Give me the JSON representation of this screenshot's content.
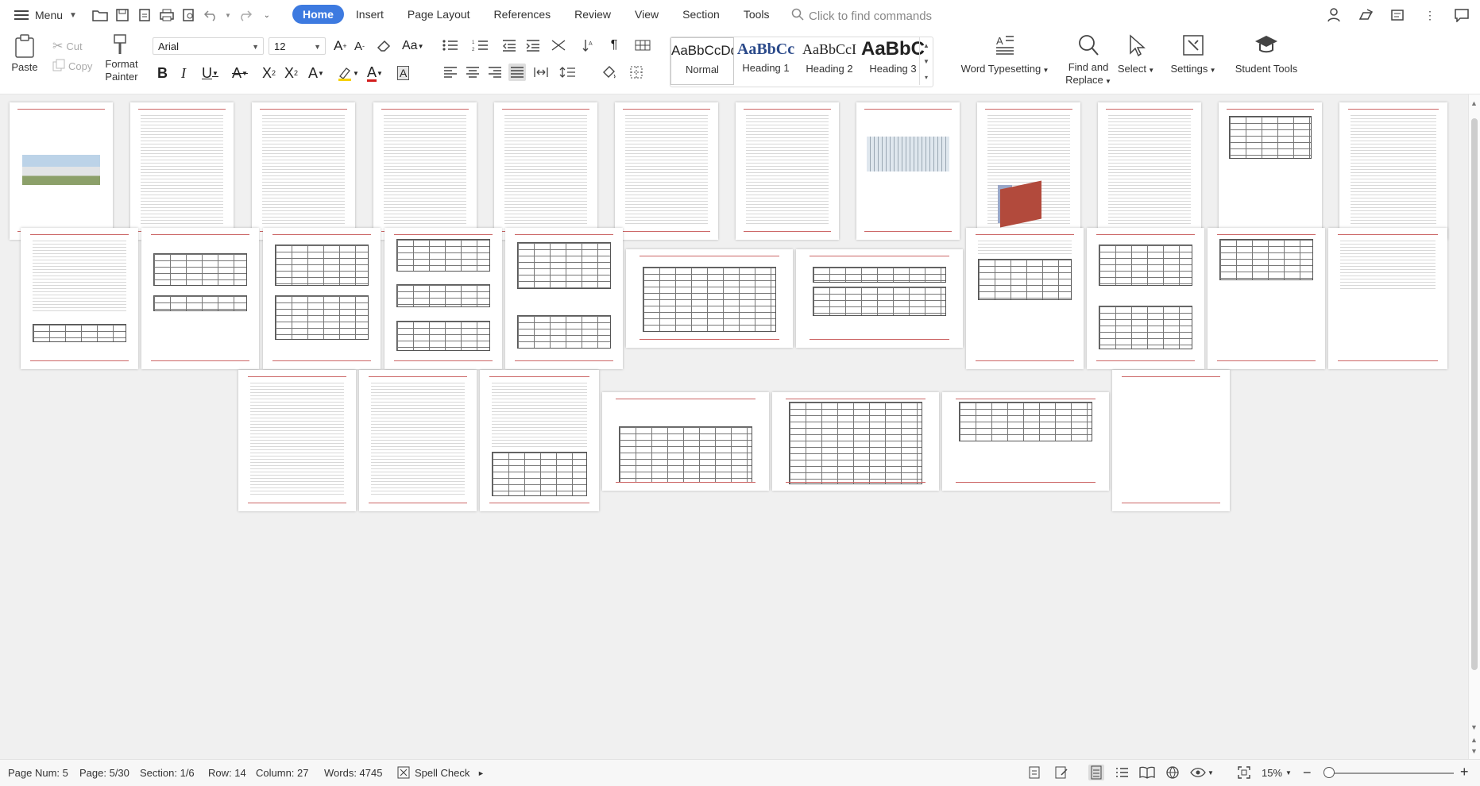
{
  "menubar": {
    "menu_label": "Menu",
    "tabs": [
      {
        "label": "Home",
        "active": true
      },
      {
        "label": "Insert"
      },
      {
        "label": "Page Layout"
      },
      {
        "label": "References"
      },
      {
        "label": "Review"
      },
      {
        "label": "View"
      },
      {
        "label": "Section"
      },
      {
        "label": "Tools"
      }
    ],
    "search_placeholder": "Click to find commands"
  },
  "ribbon": {
    "paste": "Paste",
    "cut": "Cut",
    "copy": "Copy",
    "format_painter": "Format Painter",
    "font_name": "Arial",
    "font_size": "12",
    "styles": [
      {
        "sample": "AaBbCcDd",
        "name": "Normal"
      },
      {
        "sample": "AaBbCc",
        "name": "Heading 1"
      },
      {
        "sample": "AaBbCcI",
        "name": "Heading 2"
      },
      {
        "sample": "AaBbC",
        "name": "Heading 3"
      }
    ],
    "word_typesetting": "Word Typesetting",
    "find_replace": "Find and Replace",
    "select": "Select",
    "settings": "Settings",
    "student_tools": "Student Tools"
  },
  "statusbar": {
    "page_num": "Page Num: 5",
    "page": "Page: 5/30",
    "section": "Section: 1/6",
    "row": "Row: 14",
    "column": "Column: 27",
    "words": "Words: 4745",
    "spell_check": "Spell Check",
    "zoom": "15%"
  },
  "colors": {
    "accent": "#3d7ae0",
    "header_rule": "#cc6666"
  }
}
